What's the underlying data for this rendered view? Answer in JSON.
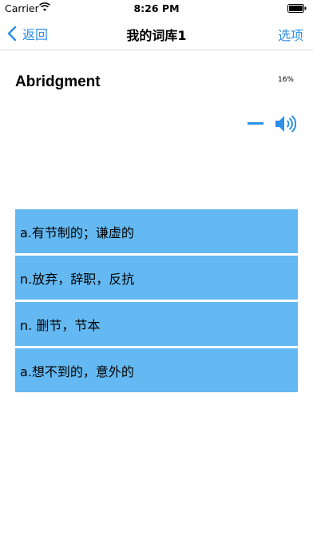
{
  "status_bar": {
    "carrier": "Carrier",
    "time": "8:26 PM"
  },
  "nav": {
    "back_label": "返回",
    "title": "我的词库1",
    "options_label": "选项"
  },
  "card": {
    "word": "Abridgment",
    "progress": "16%"
  },
  "choices": [
    {
      "label": "a.有节制的；谦虚的"
    },
    {
      "label": "n.放弃，辞职，反抗"
    },
    {
      "label": "n. 删节，节本"
    },
    {
      "label": "a.想不到的，意外的"
    }
  ],
  "colors": {
    "accent": "#2d8fe8",
    "choice_background": "#64b9f2"
  },
  "icons": [
    "wifi-icon",
    "battery-icon",
    "chevron-left-icon",
    "minus-icon",
    "speaker-icon"
  ]
}
